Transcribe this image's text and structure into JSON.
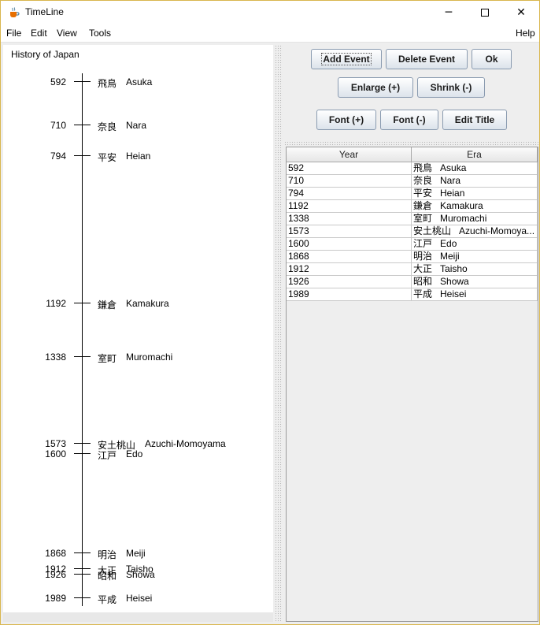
{
  "window": {
    "title": "TimeLine",
    "controls": {
      "minimize": "─",
      "close": "✕"
    }
  },
  "menu": {
    "file": "File",
    "edit": "Edit",
    "view": "View",
    "tools": "Tools",
    "help": "Help"
  },
  "timeline": {
    "title": "History of Japan",
    "events": [
      {
        "year": "592",
        "kanji": "飛鳥",
        "romaji": "Asuka"
      },
      {
        "year": "710",
        "kanji": "奈良",
        "romaji": "Nara"
      },
      {
        "year": "794",
        "kanji": "平安",
        "romaji": "Heian"
      },
      {
        "year": "1192",
        "kanji": "鎌倉",
        "romaji": "Kamakura"
      },
      {
        "year": "1338",
        "kanji": "室町",
        "romaji": "Muromachi"
      },
      {
        "year": "1573",
        "kanji": "安土桃山",
        "romaji": "Azuchi-Momoyama"
      },
      {
        "year": "1600",
        "kanji": "江戸",
        "romaji": "Edo"
      },
      {
        "year": "1868",
        "kanji": "明治",
        "romaji": "Meiji"
      },
      {
        "year": "1912",
        "kanji": "大正",
        "romaji": "Taisho"
      },
      {
        "year": "1926",
        "kanji": "昭和",
        "romaji": "Showa"
      },
      {
        "year": "1989",
        "kanji": "平成",
        "romaji": "Heisei"
      }
    ]
  },
  "buttons": {
    "add_event": "Add Event",
    "delete_event": "Delete Event",
    "ok": "Ok",
    "enlarge": "Enlarge (+)",
    "shrink": "Shrink (-)",
    "font_plus": "Font (+)",
    "font_minus": "Font (-)",
    "edit_title": "Edit Title"
  },
  "table": {
    "columns": [
      "Year",
      "Era"
    ],
    "rows": [
      {
        "year": "592",
        "kanji": "飛鳥",
        "romaji": "Asuka"
      },
      {
        "year": "710",
        "kanji": "奈良",
        "romaji": "Nara"
      },
      {
        "year": "794",
        "kanji": "平安",
        "romaji": "Heian"
      },
      {
        "year": "1192",
        "kanji": "鎌倉",
        "romaji": "Kamakura"
      },
      {
        "year": "1338",
        "kanji": "室町",
        "romaji": "Muromachi"
      },
      {
        "year": "1573",
        "kanji": "安土桃山",
        "romaji": "Azuchi-Momoya..."
      },
      {
        "year": "1600",
        "kanji": "江戸",
        "romaji": "Edo"
      },
      {
        "year": "1868",
        "kanji": "明治",
        "romaji": "Meiji"
      },
      {
        "year": "1912",
        "kanji": "大正",
        "romaji": "Taisho"
      },
      {
        "year": "1926",
        "kanji": "昭和",
        "romaji": "Showa"
      },
      {
        "year": "1989",
        "kanji": "平成",
        "romaji": "Heisei"
      }
    ]
  },
  "colors": {
    "window_border": "#d9b64e",
    "button_border": "#8a9bb0",
    "panel_bg": "#eeeeee"
  }
}
